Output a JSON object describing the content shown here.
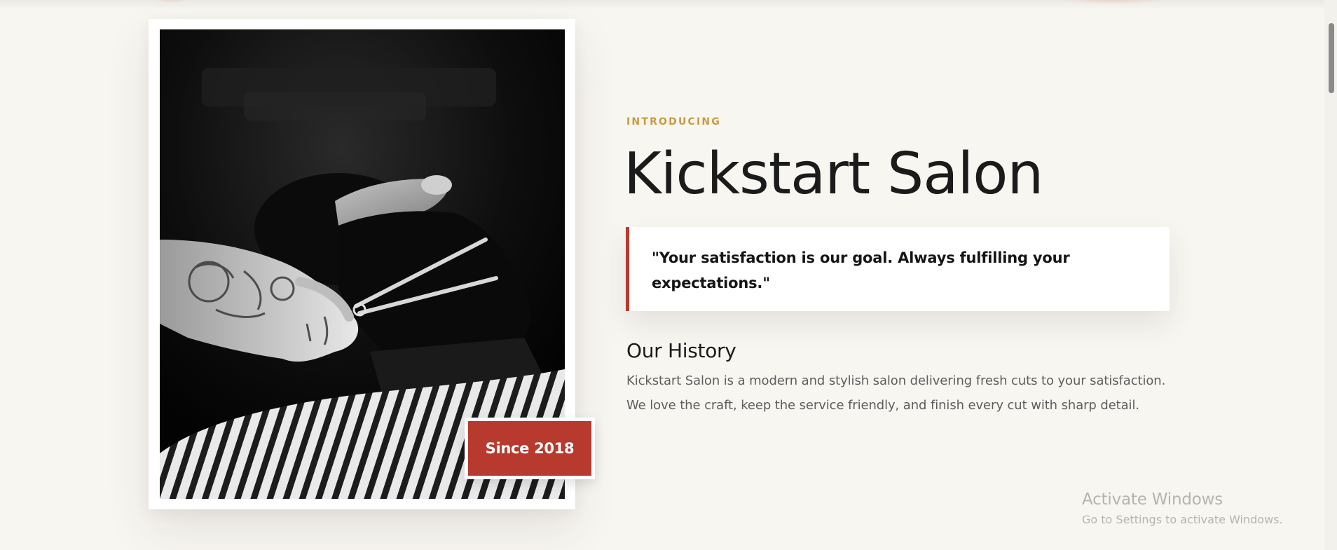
{
  "section": {
    "eyebrow": "INTRODUCING",
    "title": "Kickstart Salon",
    "quote": "\"Your satisfaction is our goal. Always fulfilling your expectations.\"",
    "history_title": "Our History",
    "history_lines": [
      "Kickstart Salon is a modern and stylish salon delivering fresh cuts to your satisfaction.",
      "We love the craft, keep the service friendly, and finish every cut with sharp detail."
    ]
  },
  "badge": {
    "label": "Since 2018"
  },
  "photo": {
    "subject": "barber-trimming-beard-photo",
    "style": "black-and-white"
  },
  "watermark": {
    "title": "Activate Windows",
    "subtitle": "Go to Settings to activate Windows."
  },
  "colors": {
    "background": "#f8f6f1",
    "accent": "#b83a2e",
    "eyebrow": "#c99a3c",
    "heading": "#1b1b1b",
    "body_text": "#5e5e5e"
  }
}
